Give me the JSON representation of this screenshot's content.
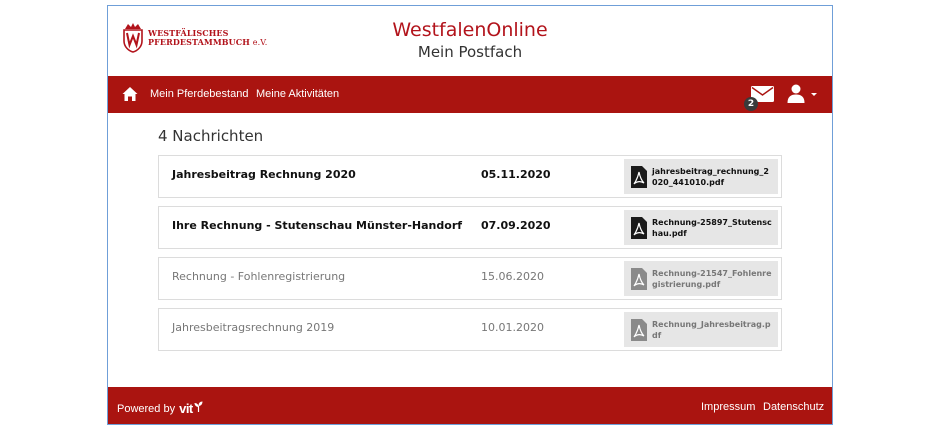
{
  "header": {
    "logo": {
      "line1": "WESTFÄLISCHES",
      "line2": "PFERDESTAMMBUCH",
      "suffix": "e.V."
    },
    "title": "WestfalenOnline",
    "subtitle": "Mein Postfach"
  },
  "nav": {
    "items": [
      {
        "label": "Mein Pferdebestand"
      },
      {
        "label": "Meine Aktivitäten"
      }
    ],
    "unread_badge": "2"
  },
  "messages": {
    "count_label": "4 Nachrichten",
    "rows": [
      {
        "subject": "Jahresbeitrag Rechnung 2020",
        "date": "05.11.2020",
        "attachment": "jahresbeitrag_rechnung_2020_441010.pdf",
        "unread": true
      },
      {
        "subject": "Ihre Rechnung - Stutenschau Münster-Handorf",
        "date": "07.09.2020",
        "attachment": "Rechnung-25897_Stutenschau.pdf",
        "unread": true
      },
      {
        "subject": "Rechnung - Fohlenregistrierung",
        "date": "15.06.2020",
        "attachment": "Rechnung-21547_Fohlenregistrierung.pdf",
        "unread": false
      },
      {
        "subject": "Jahresbeitragsrechnung 2019",
        "date": "10.01.2020",
        "attachment": "Rechnung_Jahresbeitrag.pdf",
        "unread": false
      }
    ]
  },
  "footer": {
    "powered_by": "Powered by",
    "brand": "vit",
    "links": [
      {
        "label": "Impressum"
      },
      {
        "label": "Datenschutz"
      }
    ]
  },
  "colors": {
    "brand_red": "#aa1410",
    "logo_red": "#b2131b",
    "border": "#dcdcdc",
    "attachment_bg": "#e6e6e6"
  },
  "icons": [
    "home-icon",
    "mail-icon",
    "user-icon",
    "pdf-icon",
    "shield-logo"
  ]
}
